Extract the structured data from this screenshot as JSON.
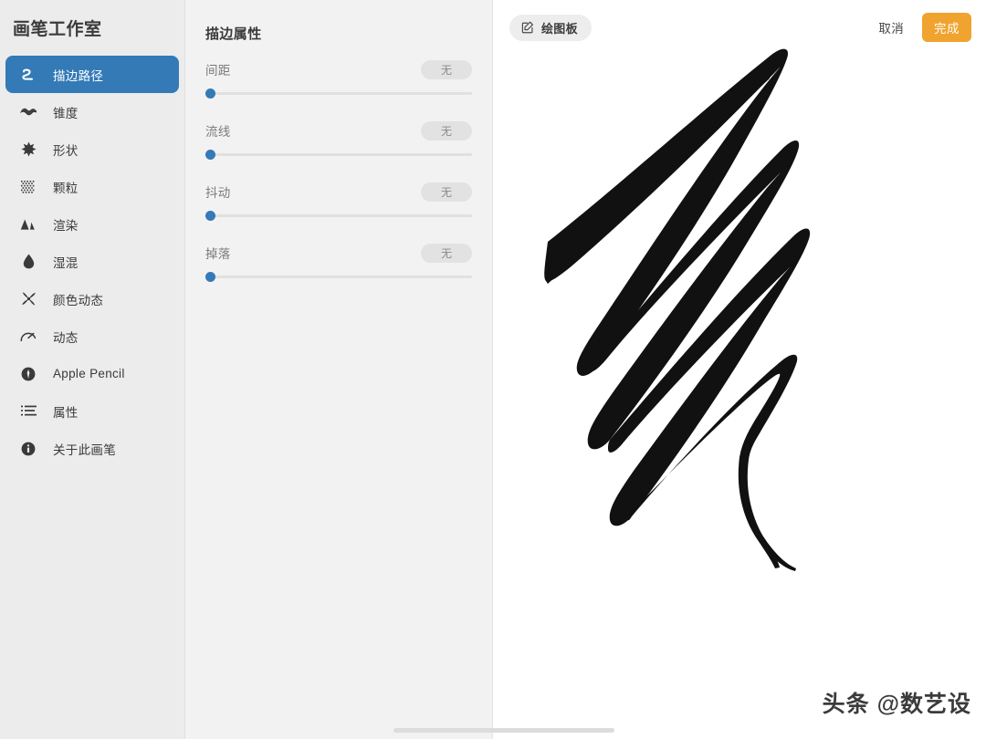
{
  "sidebar": {
    "title": "画笔工作室",
    "items": [
      {
        "label": "描边路径",
        "icon": "stroke-path-icon",
        "active": true
      },
      {
        "label": "锥度",
        "icon": "taper-wave-icon",
        "active": false
      },
      {
        "label": "形状",
        "icon": "shape-star-icon",
        "active": false
      },
      {
        "label": "颗粒",
        "icon": "grain-dots-icon",
        "active": false
      },
      {
        "label": "渲染",
        "icon": "render-mountains-icon",
        "active": false
      },
      {
        "label": "湿混",
        "icon": "wet-mix-droplet-icon",
        "active": false
      },
      {
        "label": "颜色动态",
        "icon": "color-dynamics-icon",
        "active": false
      },
      {
        "label": "动态",
        "icon": "dynamics-gauge-icon",
        "active": false
      },
      {
        "label": "Apple Pencil",
        "icon": "apple-pencil-icon",
        "active": false
      },
      {
        "label": "属性",
        "icon": "attributes-list-icon",
        "active": false
      },
      {
        "label": "关于此画笔",
        "icon": "info-circle-icon",
        "active": false
      }
    ]
  },
  "properties_panel": {
    "title": "描边属性",
    "rows": [
      {
        "label": "间距",
        "value": "无",
        "slider_percent": 0
      },
      {
        "label": "流线",
        "value": "无",
        "slider_percent": 0
      },
      {
        "label": "抖动",
        "value": "无",
        "slider_percent": 0
      },
      {
        "label": "掉落",
        "value": "无",
        "slider_percent": 0
      }
    ]
  },
  "toolbar": {
    "drawpad_label": "绘图板",
    "drawpad_icon": "edit-square-pencil-icon",
    "cancel_label": "取消",
    "done_label": "完成"
  },
  "canvas": {
    "stroke_color": "#111111",
    "background": "#ffffff",
    "watermark": "头条 @数艺设"
  },
  "colors": {
    "accent_blue": "#337ab7",
    "accent_orange": "#f0a32e",
    "sidebar_bg": "#ececec",
    "panel_bg": "#f2f2f2"
  }
}
